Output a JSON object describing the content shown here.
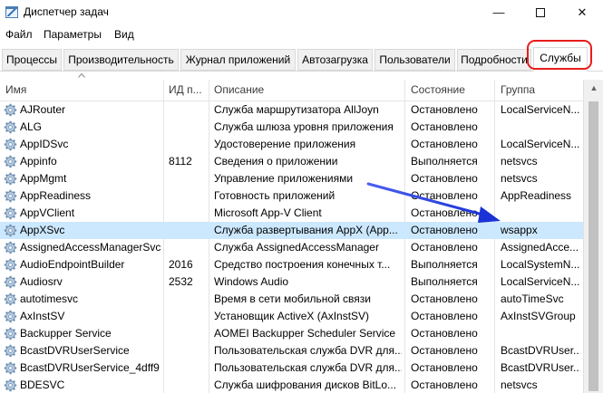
{
  "window": {
    "title": "Диспетчер задач"
  },
  "menu": [
    "Файл",
    "Параметры",
    "Вид"
  ],
  "tabs": [
    "Процессы",
    "Производительность",
    "Журнал приложений",
    "Автозагрузка",
    "Пользователи",
    "Подробности",
    "Службы"
  ],
  "active_tab": "Службы",
  "columns": [
    "Имя",
    "ИД п...",
    "Описание",
    "Состояние",
    "Группа"
  ],
  "services": [
    {
      "name": "AJRouter",
      "pid": "",
      "description": "Служба маршрутизатора AllJoyn",
      "status": "Остановлено",
      "group": "LocalServiceN..."
    },
    {
      "name": "ALG",
      "pid": "",
      "description": "Служба шлюза уровня приложения",
      "status": "Остановлено",
      "group": ""
    },
    {
      "name": "AppIDSvc",
      "pid": "",
      "description": "Удостоверение приложения",
      "status": "Остановлено",
      "group": "LocalServiceN..."
    },
    {
      "name": "Appinfo",
      "pid": "8112",
      "description": "Сведения о приложении",
      "status": "Выполняется",
      "group": "netsvcs"
    },
    {
      "name": "AppMgmt",
      "pid": "",
      "description": "Управление приложениями",
      "status": "Остановлено",
      "group": "netsvcs"
    },
    {
      "name": "AppReadiness",
      "pid": "",
      "description": "Готовность приложений",
      "status": "Остановлено",
      "group": "AppReadiness"
    },
    {
      "name": "AppVClient",
      "pid": "",
      "description": "Microsoft App-V Client",
      "status": "Остановлено",
      "group": ""
    },
    {
      "name": "AppXSvc",
      "pid": "",
      "description": "Служба развертывания AppX (App...",
      "status": "Остановлено",
      "group": "wsappx"
    },
    {
      "name": "AssignedAccessManagerSvc",
      "pid": "",
      "description": "Служба AssignedAccessManager",
      "status": "Остановлено",
      "group": "AssignedAcce..."
    },
    {
      "name": "AudioEndpointBuilder",
      "pid": "2016",
      "description": "Средство построения конечных т...",
      "status": "Выполняется",
      "group": "LocalSystemN..."
    },
    {
      "name": "Audiosrv",
      "pid": "2532",
      "description": "Windows Audio",
      "status": "Выполняется",
      "group": "LocalServiceN..."
    },
    {
      "name": "autotimesvc",
      "pid": "",
      "description": "Время в сети мобильной связи",
      "status": "Остановлено",
      "group": "autoTimeSvc"
    },
    {
      "name": "AxInstSV",
      "pid": "",
      "description": "Установщик ActiveX (AxInstSV)",
      "status": "Остановлено",
      "group": "AxInstSVGroup"
    },
    {
      "name": "Backupper Service",
      "pid": "",
      "description": "AOMEI Backupper Scheduler Service",
      "status": "Остановлено",
      "group": ""
    },
    {
      "name": "BcastDVRUserService",
      "pid": "",
      "description": "Пользовательская служба DVR для...",
      "status": "Остановлено",
      "group": "BcastDVRUser..."
    },
    {
      "name": "BcastDVRUserService_4dff9",
      "pid": "",
      "description": "Пользовательская служба DVR для...",
      "status": "Остановлено",
      "group": "BcastDVRUser..."
    },
    {
      "name": "BDESVC",
      "pid": "",
      "description": "Служба шифрования дисков BitLo...",
      "status": "Остановлено",
      "group": "netsvcs"
    }
  ],
  "selected_service": "AppXSvc",
  "colors": {
    "selected_row": "#cce8ff",
    "highlight": "#e81d1d",
    "arrow": "#1a32d6"
  },
  "icons": {
    "service": "gear-icon"
  }
}
